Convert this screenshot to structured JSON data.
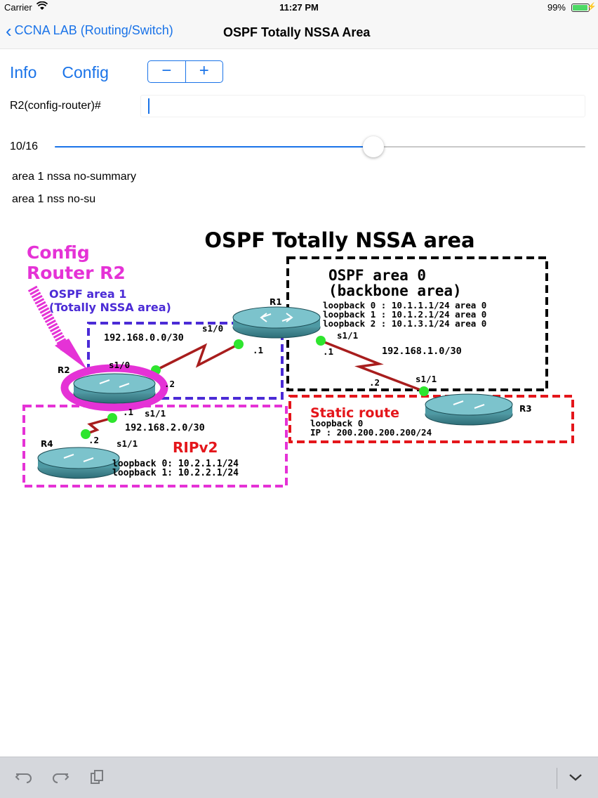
{
  "status": {
    "carrier": "Carrier",
    "time": "11:27 PM",
    "battery": "99%",
    "battery_level": 0.99
  },
  "nav": {
    "back_label": "CCNA LAB (Routing/Switch)",
    "title": "OSPF Totally NSSA Area"
  },
  "toolbar": {
    "info_label": "Info",
    "config_label": "Config",
    "minus": "−",
    "plus": "+"
  },
  "command": {
    "prompt": "R2(config-router)#",
    "value": "",
    "placeholder": ""
  },
  "progress": {
    "label": "10/16",
    "current": 10,
    "total": 16
  },
  "hints": [
    "area 1 nssa no-summary",
    "area 1 nss no-su"
  ],
  "diagram": {
    "title": "OSPF Totally NSSA area",
    "callout_line1": "Config",
    "callout_line2": "Router R2",
    "area1_line1": "OSPF area 1",
    "area1_line2": "(Totally NSSA area)",
    "area0_line1": "OSPF area 0",
    "area0_line2": "(backbone area)",
    "r1_loopbacks": [
      "loopback 0 : 10.1.1.1/24 area 0",
      "loopback 1 : 10.1.2.1/24 area 0",
      "loopback 2 : 10.1.3.1/24 area 0"
    ],
    "static_title": "Static route",
    "static_line1": "loopback 0",
    "static_line2": "IP : 200.200.200.200/24",
    "rip_title": "RIPv2",
    "r4_loopbacks": [
      "loopback 0: 10.2.1.1/24",
      "loopback 1: 10.2.2.1/24"
    ],
    "routers": {
      "r1": "R1",
      "r2": "R2",
      "r3": "R3",
      "r4": "R4"
    },
    "links": {
      "r1r2_net": "192.168.0.0/30",
      "r1_if_a": "s1/0",
      "r1_ip_a": ".1",
      "r2_if_a": "s1/0",
      "r2_ip_a": ".2",
      "r1r3_net": "192.168.1.0/30",
      "r1_if_b": "s1/1",
      "r1_ip_b": ".1",
      "r3_if": "s1/1",
      "r3_ip": ".2",
      "r2r4_net": "192.168.2.0/30",
      "r2_if_b": "s1/1",
      "r2_ip_b": ".1",
      "r4_if": "s1/1",
      "r4_ip": ".2"
    },
    "colors": {
      "area1": "#4b2bd6",
      "area0": "#000000",
      "static": "#e4161b",
      "rip": "#e532d6",
      "router": "#3f8f99",
      "link": "#a81d1d",
      "port": "#2ee52e"
    }
  }
}
